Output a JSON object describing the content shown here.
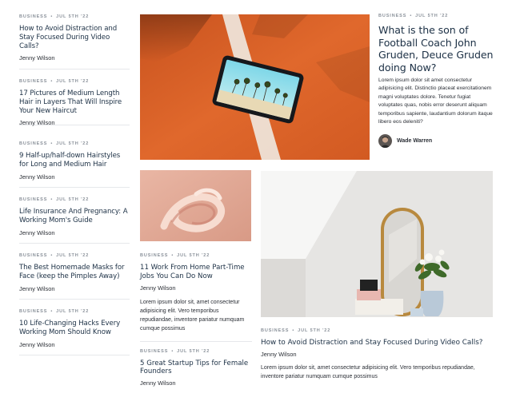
{
  "left_articles": [
    {
      "category": "BUSINESS",
      "date": "JUL 5TH '22",
      "title": "How to Avoid Distraction and Stay Focused During Video Calls?",
      "author": "Jenny Wilson"
    },
    {
      "category": "BUSINESS",
      "date": "JUL 5TH '22",
      "title": "17 Pictures of Medium Length Hair in Layers That Will Inspire Your New Haircut",
      "author": "Jenny Wilson"
    },
    {
      "category": "BUSINESS",
      "date": "JUL 5TH '22",
      "title": "9 Half-up/half-down Hairstyles for Long and Medium Hair",
      "author": "Jenny Wilson"
    },
    {
      "category": "BUSINESS",
      "date": "JUL 5TH '22",
      "title": "Life Insurance And Pregnancy: A Working Mom's Guide",
      "author": "Jenny Wilson"
    },
    {
      "category": "BUSINESS",
      "date": "JUL 5TH '22",
      "title": "The Best Homemade Masks for Face (keep the Pimples Away)",
      "author": "Jenny Wilson"
    },
    {
      "category": "BUSINESS",
      "date": "JUL 5TH '22",
      "title": "10 Life-Changing Hacks Every Working Mom Should Know",
      "author": "Jenny Wilson"
    }
  ],
  "feature": {
    "category": "BUSINESS",
    "date": "JUL 5TH '22",
    "title": "What is the son of Football Coach John Gruden, Deuce Gruden doing Now?",
    "excerpt": "Lorem ipsum dolor sit amet consectetur adipisicing elit. Distinctio placeat exercitationem magni voluptates dolore. Tenetur fugiat voluptates quas, nobis error deserunt aliquam temporibus sapiente, laudantium dolorum itaque libero eos deleniti?",
    "author": "Wade Warren"
  },
  "mid_articles": [
    {
      "category": "BUSINESS",
      "date": "JUL 5TH '22",
      "title": "11 Work From Home Part-Time Jobs You Can Do Now",
      "author": "Jenny Wilson",
      "excerpt": "Lorem ipsum dolor sit, amet consectetur adipisicing elit. Vero temporibus repudiandae, inventore pariatur numquam cumque possimus"
    },
    {
      "category": "BUSINESS",
      "date": "JUL 5TH '22",
      "title": "5 Great Startup Tips for Female Founders",
      "author": "Jenny Wilson"
    }
  ],
  "big_article": {
    "category": "BUSINESS",
    "date": "JUL 5TH '22",
    "title": "How to Avoid Distraction and Stay Focused During Video Calls?",
    "author": "Jenny Wilson",
    "excerpt": "Lorem ipsum dolor sit, amet consectetur adipisicing elit. Vero temporibus repudiandae, inventore pariatur numquam cumque possimus"
  },
  "colors": {
    "title": "#1c3045",
    "meta": "#8b929b",
    "hero_bg": "#d9602a"
  }
}
